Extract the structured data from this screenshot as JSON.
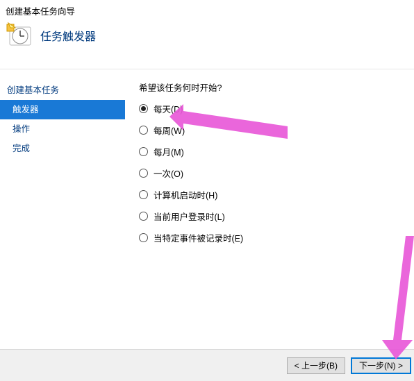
{
  "header": {
    "window_title": "创建基本任务向导",
    "section_title": "任务触发器"
  },
  "sidebar": {
    "items": [
      {
        "label": "创建基本任务"
      },
      {
        "label": "触发器"
      },
      {
        "label": "操作"
      },
      {
        "label": "完成"
      }
    ],
    "selected_index": 1
  },
  "main": {
    "question": "希望该任务何时开始?",
    "options": [
      {
        "label": "每天(D)"
      },
      {
        "label": "每周(W)"
      },
      {
        "label": "每月(M)"
      },
      {
        "label": "一次(O)"
      },
      {
        "label": "计算机启动时(H)"
      },
      {
        "label": "当前用户登录时(L)"
      },
      {
        "label": "当特定事件被记录时(E)"
      }
    ],
    "selected_option": 0
  },
  "footer": {
    "back_label": "< 上一步(B)",
    "next_label": "下一步(N) >"
  },
  "annotation": {
    "arrow1_target": "daily-option",
    "arrow2_target": "next-button"
  }
}
